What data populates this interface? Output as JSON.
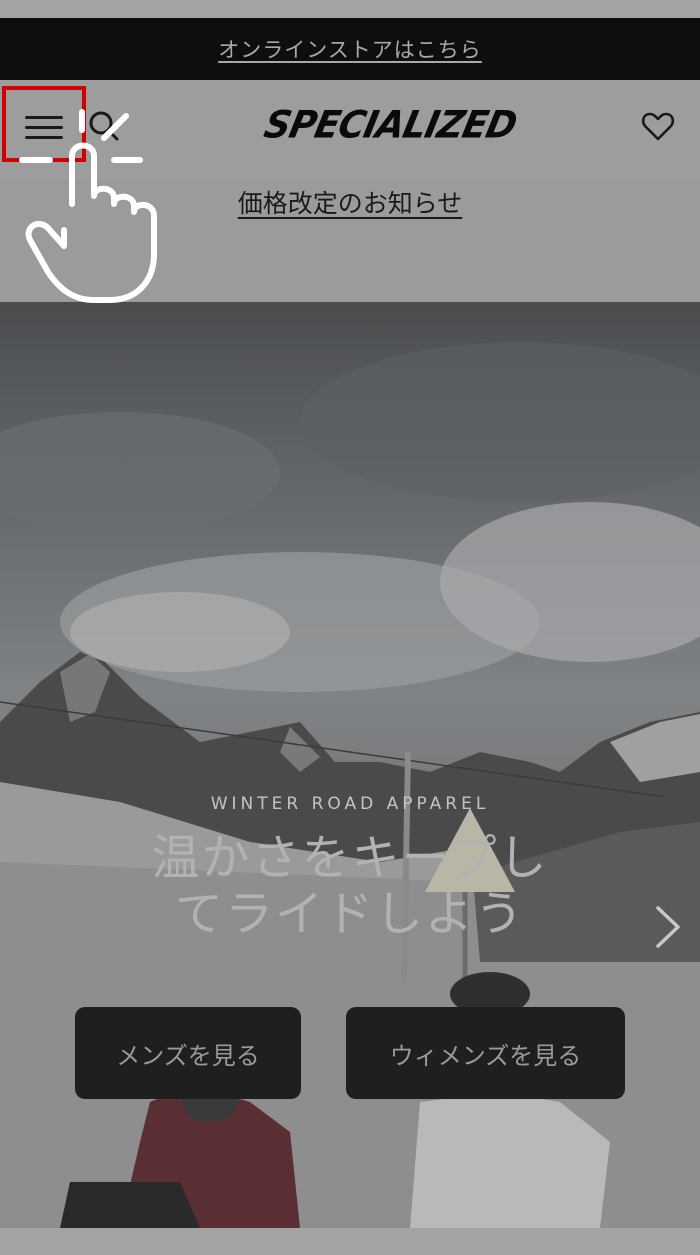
{
  "promo_bar": {
    "link_text": "オンラインストアはこちら"
  },
  "header": {
    "logo_text": "SPECIALIZED",
    "menu_icon": "hamburger-menu-icon",
    "search_icon": "search-icon",
    "favorite_icon": "heart-icon"
  },
  "notice": {
    "link_text": "価格改定のお知らせ"
  },
  "hero": {
    "subtitle": "WINTER ROAD APPAREL",
    "title_line1": "温かさをキープし",
    "title_line2": "てライドしよう",
    "next_icon": "chevron-right-icon",
    "buttons": {
      "mens": "メンズを見る",
      "womens": "ウィメンズを見る"
    }
  },
  "overlay": {
    "tap_hint_icon": "tap-hand-icon"
  },
  "colors": {
    "highlight": "#d10000",
    "promo_bg": "#0e0e0e",
    "cta_bg": "#1f1f1f"
  }
}
